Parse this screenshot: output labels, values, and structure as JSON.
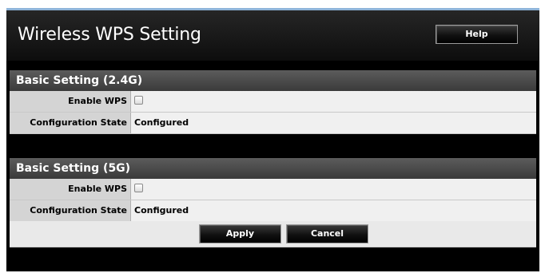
{
  "header": {
    "title": "Wireless WPS Setting",
    "help_label": "Help"
  },
  "sections": [
    {
      "title": "Basic Setting (2.4G)",
      "rows": [
        {
          "label": "Enable WPS",
          "checked": false
        },
        {
          "label": "Configuration State",
          "value": "Configured"
        }
      ]
    },
    {
      "title": "Basic Setting (5G)",
      "rows": [
        {
          "label": "Enable WPS",
          "checked": false
        },
        {
          "label": "Configuration State",
          "value": "Configured"
        }
      ]
    }
  ],
  "actions": {
    "apply_label": "Apply",
    "cancel_label": "Cancel"
  },
  "colors": {
    "accent_border": "#8fb4d9",
    "background": "#000000",
    "section_header": "#4a4a4a",
    "label_cell": "#d4d4d4",
    "value_cell": "#f0f0f0"
  }
}
